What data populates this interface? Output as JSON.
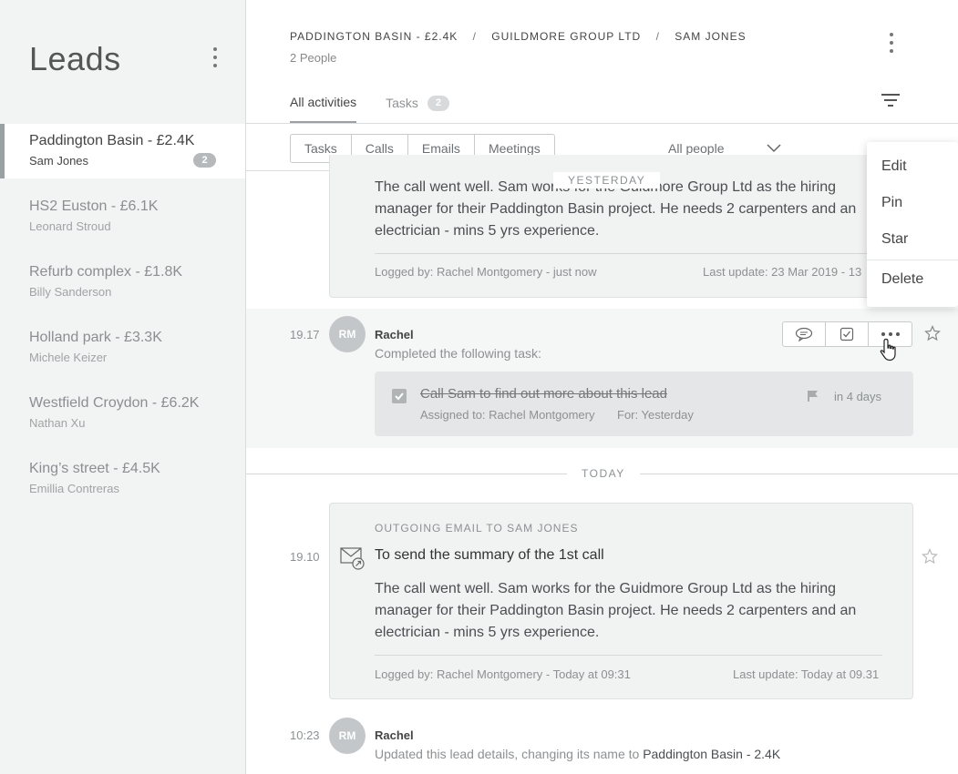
{
  "sidebar": {
    "title": "Leads",
    "leads": [
      {
        "name": "Paddington Basin - £2.4K",
        "person": "Sam Jones",
        "count": "2"
      },
      {
        "name": "HS2 Euston - £6.1K",
        "person": "Leonard Stroud"
      },
      {
        "name": "Refurb complex - £1.8K",
        "person": "Billy Sanderson"
      },
      {
        "name": "Holland park - £3.3K",
        "person": "Michele Keizer"
      },
      {
        "name": "Westfield Croydon - £6.2K",
        "person": "Nathan Xu"
      },
      {
        "name": "King’s street - £4.5K",
        "person": "Emillia Contreras"
      }
    ]
  },
  "header": {
    "breadcrumb": [
      "PADDINGTON BASIN - £2.4K",
      "GUILDMORE GROUP LTD",
      "SAM JONES"
    ],
    "separator": "/",
    "people": "2 People",
    "tabs": [
      {
        "label": "All activities"
      },
      {
        "label": "Tasks",
        "badge": "2"
      }
    ]
  },
  "filters": {
    "types": [
      "Tasks",
      "Calls",
      "Emails",
      "Meetings"
    ],
    "people": "All people"
  },
  "feed": {
    "yesterday_label": "YESTERDAY",
    "today_label": "TODAY",
    "top_card": {
      "body": "The call went well. Sam works for the Guidmore Group Ltd as the hiring manager for their Paddington Basin project. He needs 2 carpenters and an electrician - mins 5 yrs experience.",
      "logged": "Logged by: Rachel Montgomery - just now",
      "updated": "Last update: 23 Mar 2019 - 13"
    },
    "task_entry": {
      "time": "19.17",
      "initials": "RM",
      "author": "Rachel",
      "desc": "Completed the following task:",
      "task_title": "Call Sam to find out more about this lead",
      "assigned": "Assigned to: Rachel Montgomery",
      "for": "For: Yesterday",
      "due": "in 4 days"
    },
    "email_entry": {
      "time": "19.10",
      "kind": "OUTGOING EMAIL TO SAM JONES",
      "subject": "To send the summary of the 1st call",
      "body": "The call went well. Sam works for the Guidmore Group Ltd as the hiring manager for their Paddington Basin project. He needs 2 carpenters and an electrician - mins 5 yrs experience.",
      "logged": "Logged by: Rachel Montgomery - Today at  09:31",
      "updated": "Last update: Today at 09.31"
    },
    "update_entry": {
      "time": "10:23",
      "initials": "RM",
      "author": "Rachel",
      "desc": "Updated this lead details, changing its name to",
      "new_name": "Paddington Basin - 2.4K"
    }
  },
  "menu": {
    "items": [
      "Edit",
      "Pin",
      "Star",
      "Delete"
    ]
  }
}
